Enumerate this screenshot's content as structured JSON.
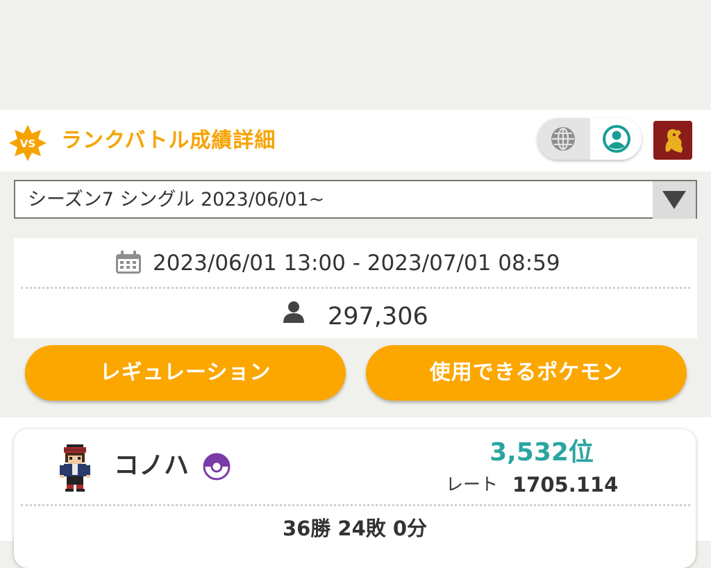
{
  "header": {
    "title": "ランクバトル成績詳細",
    "badge_text": "VS",
    "icons": [
      "vs-badge-icon",
      "globe-icon",
      "account-icon",
      "region-emblem-icon"
    ]
  },
  "season_select": {
    "selected": "シーズン7 シングル 2023/06/01~"
  },
  "season_info": {
    "period": "2023/06/01 13:00 - 2023/07/01 08:59",
    "players": "297,306"
  },
  "buttons": {
    "regulation": "レギュレーション",
    "usable_pokemon": "使用できるポケモン"
  },
  "ranking": {
    "trainer_name": "コノハ",
    "rank": "3,532位",
    "rate_label": "レート",
    "rate_value": "1705.114",
    "record": "36勝 24敗 0分"
  },
  "colors": {
    "accent_orange": "#fca700",
    "title_orange": "#f5a300",
    "rank_teal": "#2aa6a0",
    "ball_purple": "#7a3aa8",
    "emblem_red": "#8a1c1a"
  }
}
